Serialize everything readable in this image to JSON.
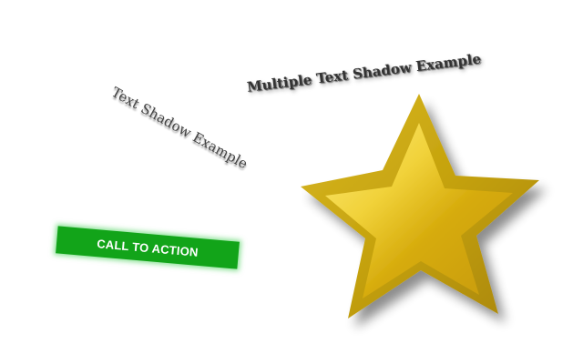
{
  "texts": {
    "single_shadow": "Text Shadow Example",
    "multiple_shadow": "Multiple Text Shadow Example"
  },
  "cta": {
    "label": "CALL TO ACTION",
    "color": "#12a419"
  },
  "star": {
    "icon": "star-icon",
    "colors": {
      "outer": "#c9a50e",
      "inner_light": "#f6dc4e",
      "inner_dark": "#c99a06"
    }
  }
}
